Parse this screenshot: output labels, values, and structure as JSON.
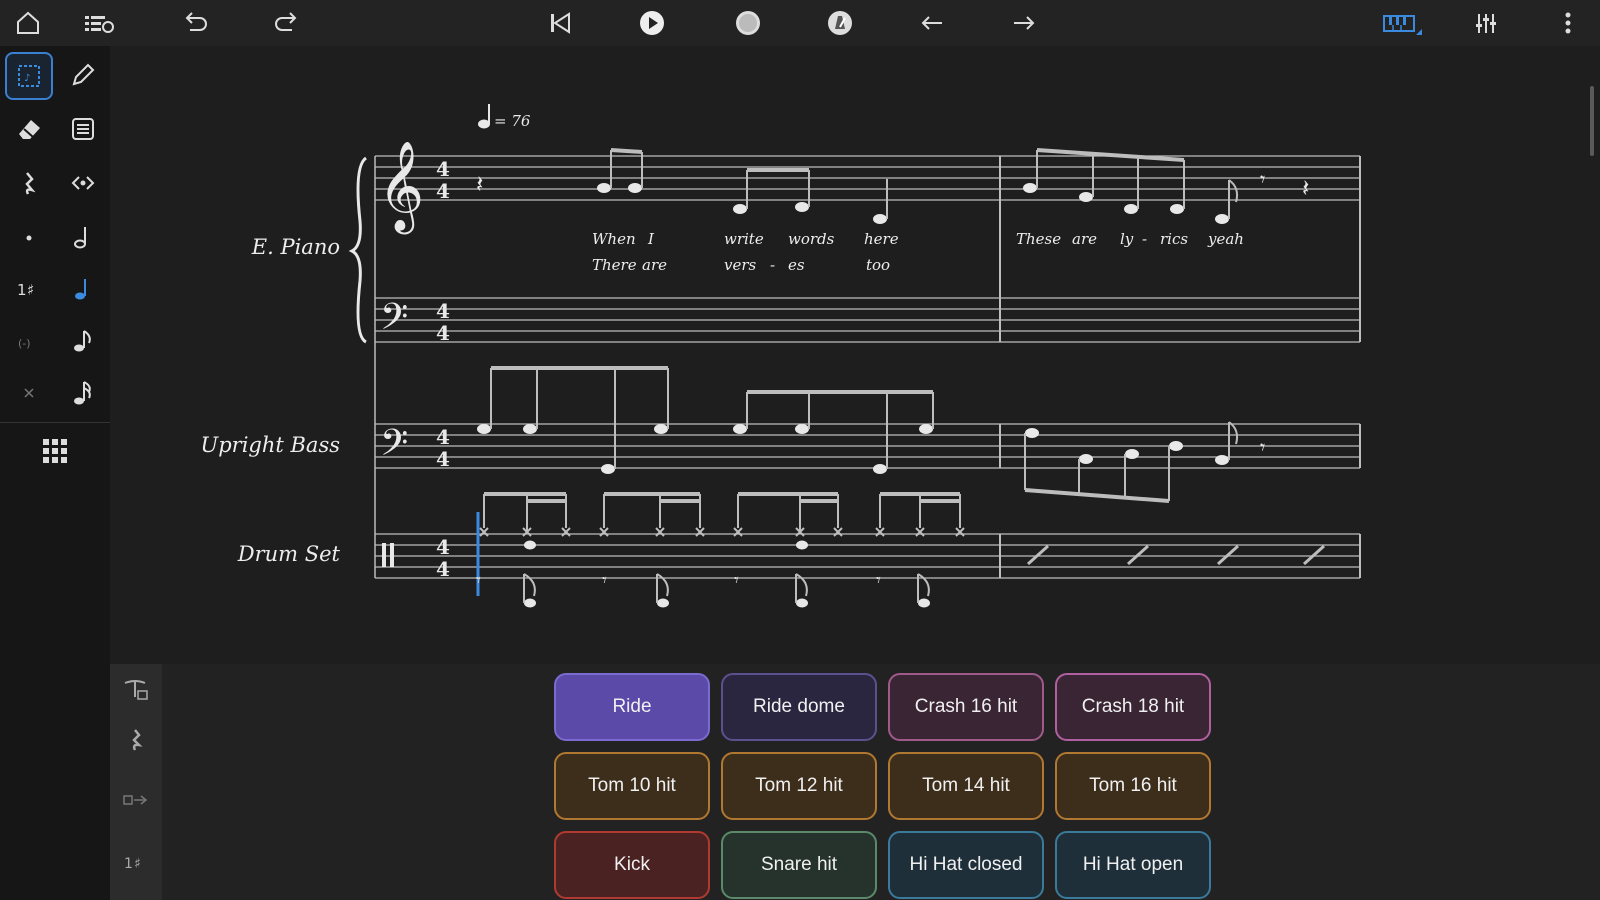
{
  "toolbar": {
    "icons": [
      "home-icon",
      "library-icon",
      "undo-icon",
      "redo-icon",
      "skip-to-start-icon",
      "play-icon",
      "record-icon",
      "metronome-icon",
      "arrow-left-icon",
      "arrow-right-icon",
      "piano-keyboard-icon",
      "mixer-icon",
      "more-vertical-icon"
    ],
    "accent": "#3a8be0"
  },
  "sidebar": {
    "tools": [
      "select-tool",
      "pencil-tool",
      "eraser-tool",
      "clipboard-tool",
      "rest-tool",
      "flip-tool",
      "dot-tool",
      "half-note-tool",
      "accidental-tool",
      "quarter-note-tool",
      "tuplet-tool",
      "eighth-note-tool",
      "tie-tool",
      "sixteenth-note-tool",
      "grid-menu"
    ],
    "active_tool": "select-tool",
    "active_duration": "quarter-note-tool"
  },
  "score": {
    "tempo_value": "= 76",
    "instruments": [
      "E. Piano",
      "Upright Bass",
      "Drum Set"
    ],
    "time_signature": [
      "4",
      "4"
    ],
    "lyrics": {
      "measure1_line1": [
        "When",
        "I",
        "write",
        "words",
        "here"
      ],
      "measure1_line2": [
        "There",
        "are",
        "vers",
        "-",
        "es",
        "too"
      ],
      "measure2_line1": [
        "These",
        "are",
        "ly",
        "-",
        "rics",
        "yeah"
      ]
    }
  },
  "pads": {
    "rows": [
      [
        {
          "label": "Ride",
          "bg": "#5b4aa8",
          "border": "#7b6ad0"
        },
        {
          "label": "Ride dome",
          "bg": "#2b2640",
          "border": "#5d508f"
        },
        {
          "label": "Crash 16 hit",
          "bg": "#3a2535",
          "border": "#a05a8a"
        },
        {
          "label": "Crash 18 hit",
          "bg": "#3a2535",
          "border": "#b060a0"
        }
      ],
      [
        {
          "label": "Tom 10 hit",
          "bg": "#3d2e1c",
          "border": "#b07830"
        },
        {
          "label": "Tom 12 hit",
          "bg": "#3d2e1c",
          "border": "#b07830"
        },
        {
          "label": "Tom 14 hit",
          "bg": "#3d2e1c",
          "border": "#b07830"
        },
        {
          "label": "Tom 16 hit",
          "bg": "#3d2e1c",
          "border": "#b07830"
        }
      ],
      [
        {
          "label": "Kick",
          "bg": "#4a2222",
          "border": "#b03a32"
        },
        {
          "label": "Snare hit",
          "bg": "#26332c",
          "border": "#5a8a6a"
        },
        {
          "label": "Hi Hat closed",
          "bg": "#1f2f3a",
          "border": "#3a7a9a"
        },
        {
          "label": "Hi Hat open",
          "bg": "#1f2f3a",
          "border": "#3a7a9a"
        }
      ]
    ]
  }
}
